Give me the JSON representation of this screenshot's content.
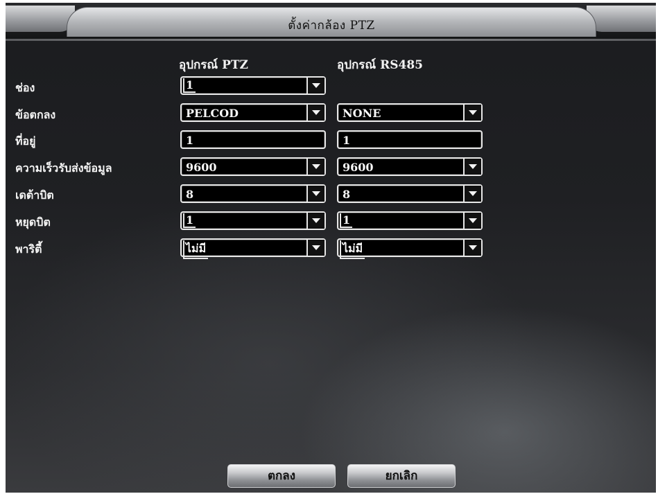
{
  "window": {
    "title": "ตั้งค่ากล้อง PTZ"
  },
  "columns": {
    "ptz_device": "อุปกรณ์ PTZ",
    "rs485_device": "อุปกรณ์ RS485"
  },
  "rows": {
    "channel": {
      "label": "ช่อง",
      "ptz_value": "1"
    },
    "protocol": {
      "label": "ข้อตกลง",
      "ptz_value": "PELCOD",
      "rs485_value": "NONE"
    },
    "address": {
      "label": "ที่อยู่",
      "ptz_value": "1",
      "rs485_value": "1"
    },
    "baudrate": {
      "label": "ความเร็วรับส่งข้อมูล",
      "ptz_value": "9600",
      "rs485_value": "9600"
    },
    "databit": {
      "label": "เดต้าบิต",
      "ptz_value": "8",
      "rs485_value": "8"
    },
    "stopbit": {
      "label": "หยุดบิต",
      "ptz_value": "1",
      "rs485_value": "1"
    },
    "parity": {
      "label": "พาริตี้",
      "ptz_value": "ไม่มี",
      "rs485_value": "ไม่มี"
    }
  },
  "buttons": {
    "ok": "ตกลง",
    "cancel": "ยกเลิก"
  },
  "icons": {
    "dropdown": "chevron-down-icon"
  }
}
